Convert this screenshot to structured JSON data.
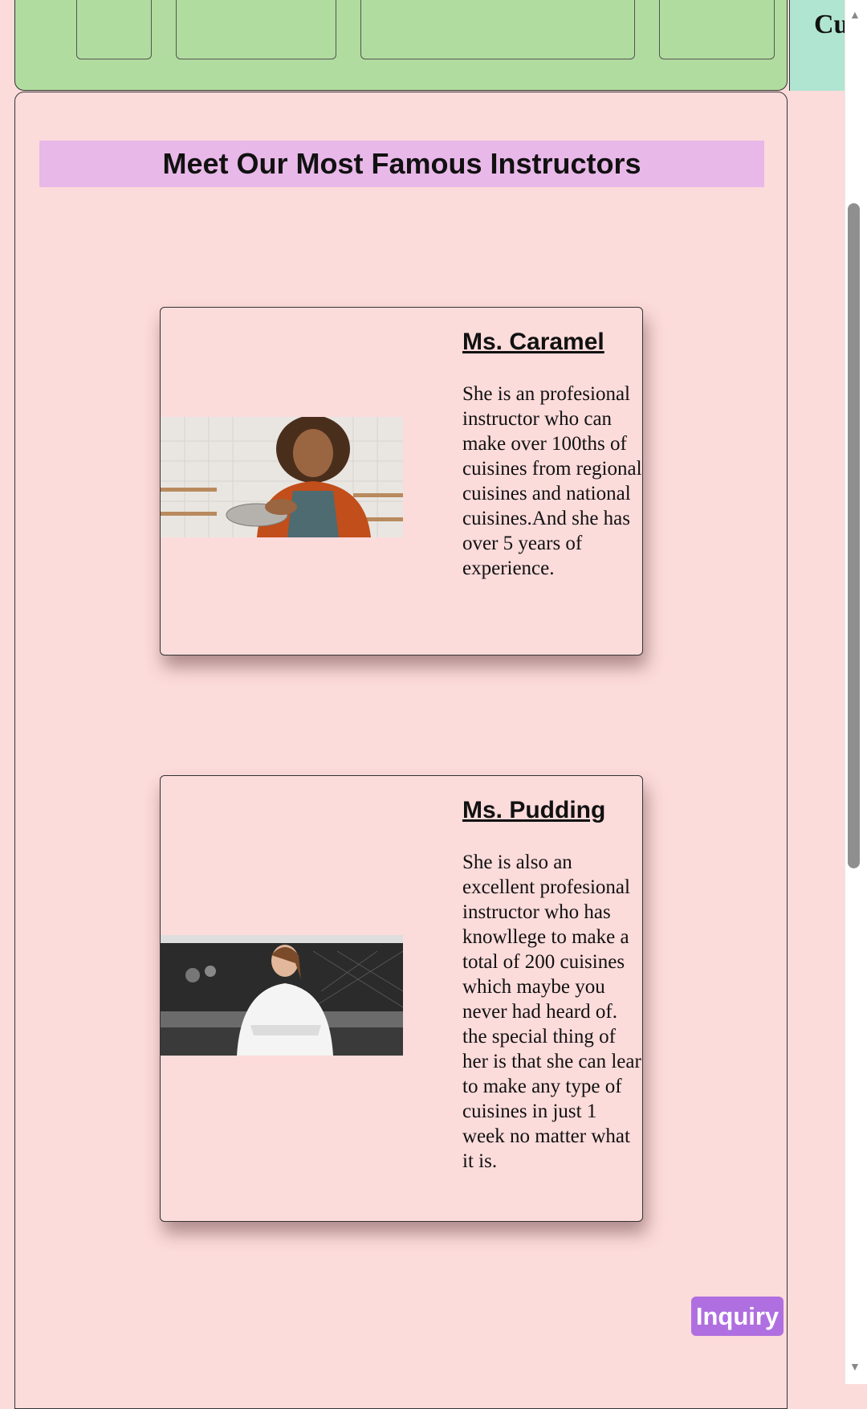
{
  "nav": {
    "side_label": "Cu"
  },
  "section": {
    "heading": "Meet Our Most Famous Instructors"
  },
  "instructors": [
    {
      "name": "Ms. Caramel",
      "description": "She is an profesional instructor who can make over 100ths of cuisines from regional cuisines and national cuisines.And she has over 5 years of experience.",
      "photo_alt": "Smiling woman in orange sweater and apron whisking in a bowl in a kitchen"
    },
    {
      "name": "Ms. Pudding",
      "description": "She is also an excellent profesional instructor who has knowllege to make a total of 200 cuisines which maybe you never had heard of. the special thing of her is that she can lear to make any type of cuisines in just 1 week no matter what it is.",
      "photo_alt": "Smiling chef in white jacket with crossed arms in a professional kitchen"
    }
  ],
  "inquiry_label": "Inquiry",
  "colors": {
    "nav_bg": "#b1dc9f",
    "side_panel_bg": "#b0e5d2",
    "page_bg": "#fcdbdb",
    "heading_bg": "#e8b8e8",
    "button_bg": "#b06fe0"
  },
  "scrollbar": {
    "up_icon": "triangle-up",
    "down_icon": "triangle-down"
  }
}
